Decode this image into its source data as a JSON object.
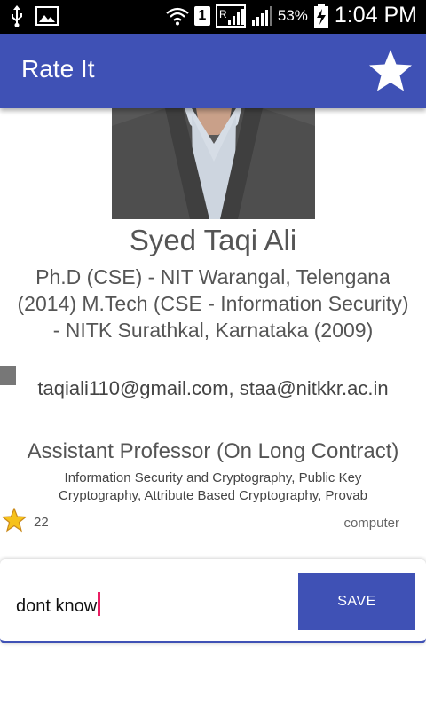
{
  "status_bar": {
    "battery": "53%",
    "time": "1:04 PM",
    "sim": "1"
  },
  "app_bar": {
    "title": "Rate It",
    "action_icon": "star-icon",
    "color": "#3f51b5"
  },
  "profile": {
    "name": "Syed Taqi Ali",
    "qualification": "Ph.D (CSE) - NIT Warangal, Telengana (2014) M.Tech (CSE - Information Security) - NITK Surathkal, Karnataka (2009)",
    "email": "taqiali110@gmail.com, staa@nitkkr.ac.in",
    "position": "Assistant Professor (On Long Contract)",
    "interests": "Information Security and Cryptography, Public Key Cryptography, Attribute Based Cryptography, Provab",
    "rating_count": "22",
    "department": "computer"
  },
  "comment": {
    "value": "dont know",
    "save_label": "SAVE"
  }
}
